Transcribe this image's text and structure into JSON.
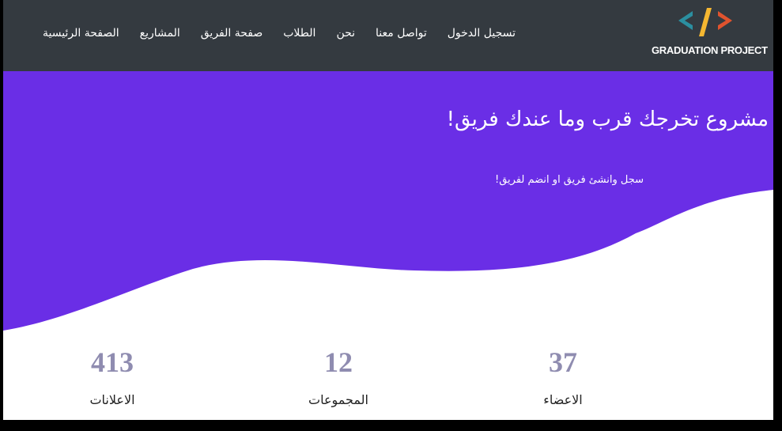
{
  "brand": {
    "logo_text": "GRADUATION PROJECT",
    "colors": {
      "left_bracket": "#2b8fa0",
      "slash": "#f5b731",
      "right_bracket": "#e0532e"
    }
  },
  "nav": {
    "items": [
      {
        "label": "الصفحة الرئيسية"
      },
      {
        "label": "المشاريع"
      },
      {
        "label": "صفحة الفريق"
      },
      {
        "label": "الطلاب"
      },
      {
        "label": "نحن"
      },
      {
        "label": "تواصل معنا"
      },
      {
        "label": "تسجيل الدخول"
      }
    ],
    "background": "#343a40"
  },
  "hero": {
    "title": "مشروع تخرجك قرب وما عندك فريق!",
    "subtitle": "سجل وانشئ فريق او انضم لفريق!",
    "background": "#6a2ee6"
  },
  "stats": [
    {
      "value": "37",
      "label": "الاعضاء"
    },
    {
      "value": "12",
      "label": "المجموعات"
    },
    {
      "value": "413",
      "label": "الاعلانات"
    }
  ]
}
